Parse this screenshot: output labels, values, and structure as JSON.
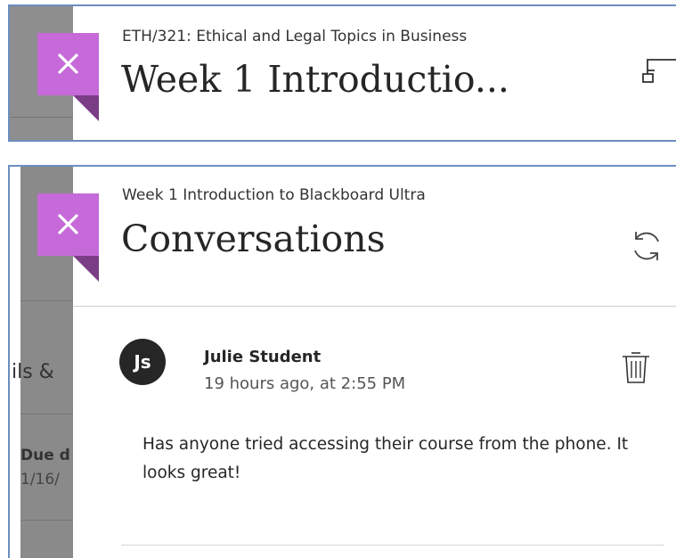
{
  "back_panel": {
    "course_label": "ETH/321: Ethical and Legal Topics in Business",
    "title": "Week 1 Introductio...",
    "close_icon": "close-x-icon",
    "action_icon": "hierarchy-icon"
  },
  "front_panel": {
    "breadcrumb": "Week 1 Introduction to Blackboard Ultra",
    "title": "Conversations",
    "close_icon": "close-x-icon",
    "refresh_icon": "refresh-icon"
  },
  "post": {
    "avatar_initials": "Js",
    "author": "Julie Student",
    "time": "19 hours ago, at 2:55 PM",
    "body": "Has anyone tried accessing their course from the phone. It looks great!",
    "delete_icon": "trash-icon"
  },
  "background_fragments": {
    "details_fragment": "ils &",
    "due_label_fragment": "Due d",
    "due_date_fragment": "1/16/"
  },
  "colors": {
    "accent_purple": "#c56ad8",
    "accent_purple_dark": "#7a3d86",
    "panel_border": "#6c8ebf",
    "avatar_bg": "#262626"
  }
}
